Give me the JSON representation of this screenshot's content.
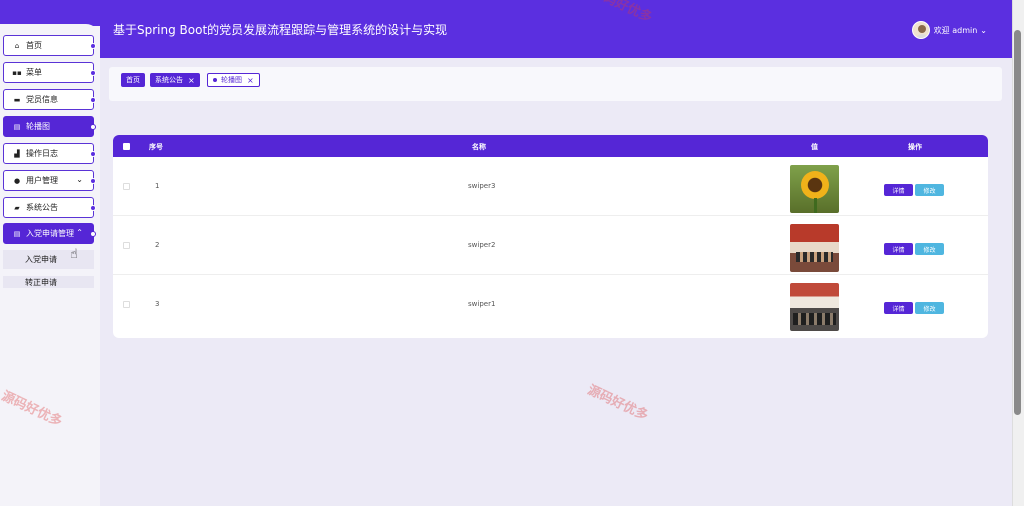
{
  "header": {
    "title": "基于Spring Boot的党员发展流程跟踪与管理系统的设计与实现",
    "user_label": "欢迎 admin",
    "user_chevron": "⌄"
  },
  "sidebar": {
    "items": [
      {
        "label": "首页",
        "icon": "home-icon",
        "glyph": "⌂"
      },
      {
        "label": "菜单",
        "icon": "grid-icon",
        "glyph": "▪▪"
      },
      {
        "label": "党员信息",
        "icon": "card-icon",
        "glyph": "▬"
      },
      {
        "label": "轮播图",
        "icon": "table-icon",
        "glyph": "▤"
      },
      {
        "label": "操作日志",
        "icon": "chart-icon",
        "glyph": "▟"
      },
      {
        "label": "用户管理",
        "icon": "user-icon",
        "glyph": "●",
        "chevron": "⌄"
      },
      {
        "label": "系统公告",
        "icon": "copy-icon",
        "glyph": "▰"
      },
      {
        "label": "入党申请管理",
        "icon": "table-icon",
        "glyph": "▤",
        "chevron": "⌃"
      }
    ],
    "sub_items": [
      "入党申请",
      "转正申请"
    ]
  },
  "tabs": [
    {
      "label": "首页"
    },
    {
      "label": "系统公告",
      "close": "×"
    },
    {
      "label": "轮播图",
      "close": "×"
    }
  ],
  "table": {
    "columns": [
      "序号",
      "名称",
      "值",
      "操作"
    ],
    "rows": [
      {
        "seq": "1",
        "name": "swiper3",
        "image": "sunflower"
      },
      {
        "seq": "2",
        "name": "swiper2",
        "image": "meeting-hall"
      },
      {
        "seq": "3",
        "name": "swiper1",
        "image": "meeting-room"
      }
    ],
    "detail_label": "详情",
    "edit_label": "修改"
  },
  "watermark": "源码好优多",
  "colors": {
    "primary": "#5526d6",
    "header": "#5b2fe0",
    "edit_button": "#4fb6e0",
    "background": "#eceaf6"
  }
}
